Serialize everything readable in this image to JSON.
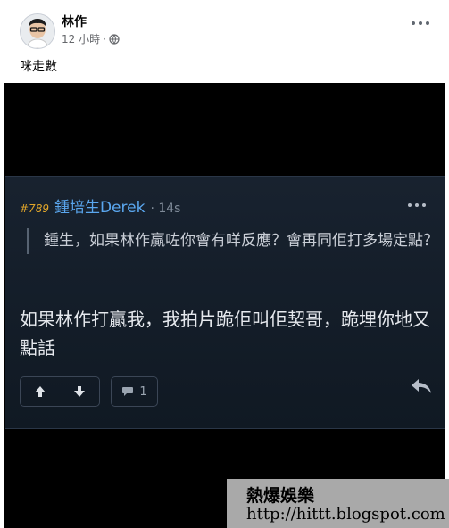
{
  "post": {
    "author": "林作",
    "time": "12 小時",
    "separator": "·",
    "caption": "咪走數",
    "privacy_icon": "globe-icon",
    "more_icon": "more-horizontal-icon"
  },
  "card": {
    "post_number": "#789",
    "username": "鍾培生Derek",
    "time": "· 14s",
    "quote_text": "鍾生，如果林作贏咗你會有咩反應？會再同佢打多場定點？",
    "reply_text": "如果林作打贏我，我拍片跪佢叫佢契哥，跪埋你地又點話",
    "comment_count": "1",
    "icons": {
      "upvote": "arrow-up-icon",
      "downvote": "arrow-down-icon",
      "comment": "comment-icon",
      "share": "reply-arrow-icon"
    }
  },
  "watermark": {
    "line1": "熱爆娛樂",
    "line2": "http://hittt.blogspot.com"
  }
}
